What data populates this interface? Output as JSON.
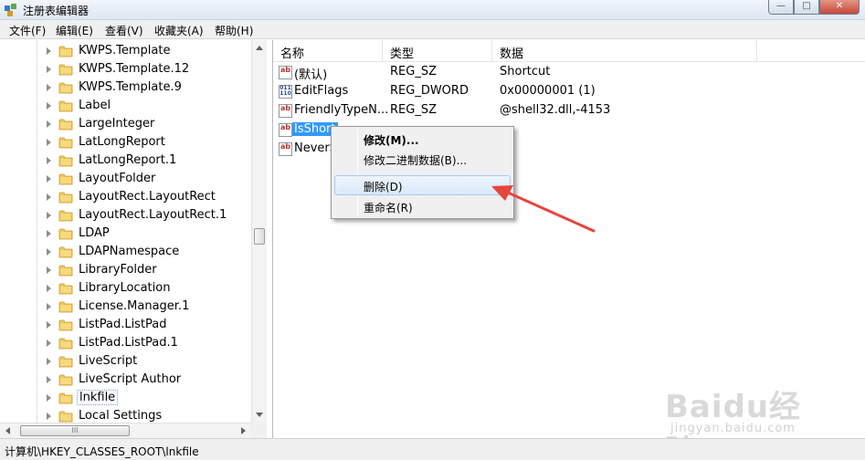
{
  "window": {
    "title": "注册表编辑器",
    "minimize": "—",
    "maximize": "□",
    "close": "✕"
  },
  "menu": [
    "文件(F)",
    "编辑(E)",
    "查看(V)",
    "收藏夹(A)",
    "帮助(H)"
  ],
  "tree": {
    "items": [
      "KWPS.Template",
      "KWPS.Template.12",
      "KWPS.Template.9",
      "Label",
      "LargeInteger",
      "LatLongReport",
      "LatLongReport.1",
      "LayoutFolder",
      "LayoutRect.LayoutRect",
      "LayoutRect.LayoutRect.1",
      "LDAP",
      "LDAPNamespace",
      "LibraryFolder",
      "LibraryLocation",
      "License.Manager.1",
      "ListPad.ListPad",
      "ListPad.ListPad.1",
      "LiveScript",
      "LiveScript Author",
      "lnkfile",
      "Local Settings"
    ],
    "selected": "lnkfile",
    "hscroll_grip": "III"
  },
  "list": {
    "columns": [
      "名称",
      "类型",
      "数据"
    ],
    "rows": [
      {
        "name": "(默认)",
        "type": "REG_SZ",
        "data": "Shortcut",
        "icon": "string-value-icon"
      },
      {
        "name": "EditFlags",
        "type": "REG_DWORD",
        "data": "0x00000001 (1)",
        "icon": "binary-value-icon"
      },
      {
        "name": "FriendlyTypeN...",
        "type": "REG_SZ",
        "data": "@shell32.dll,-4153",
        "icon": "string-value-icon"
      },
      {
        "name": "IsShort",
        "type": "",
        "data": "",
        "icon": "string-value-icon"
      },
      {
        "name": "NeverS",
        "type": "",
        "data": "",
        "icon": "string-value-icon"
      }
    ],
    "icon_text_string": "ab",
    "icon_text_binary": "011 110"
  },
  "context_menu": {
    "modify": "修改(M)...",
    "modify_binary": "修改二进制数据(B)...",
    "delete": "删除(D)",
    "rename": "重命名(R)"
  },
  "annotation": {
    "arrow_color": "#e8453c"
  },
  "statusbar": {
    "path": "计算机\\HKEY_CLASSES_ROOT\\lnkfile"
  },
  "watermark": {
    "brand": "Baidu经验",
    "sub": "jingyan.baidu.com"
  }
}
